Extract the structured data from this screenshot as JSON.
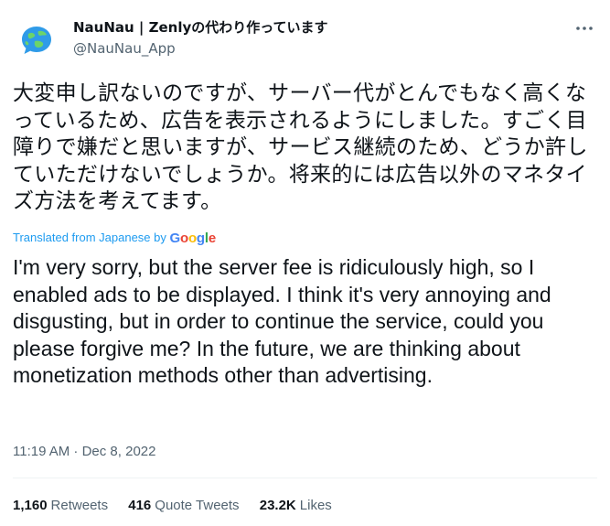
{
  "author": {
    "display_name": "NauNau | Zenlyの代わり作っています",
    "handle": "@NauNau_App",
    "avatar_icon": "globe-chat-bubble-icon"
  },
  "more_button_icon": "more-horizontal-icon",
  "tweet": {
    "original_text": "大変申し訳ないのですが、サーバー代がとんでもなく高くなっているため、広告を表示されるようにしました。すごく目障りで嫌だと思いますが、サービス継続のため、どうか許していただけないでしょうか。将来的には広告以外のマネタイズ方法を考えてます。",
    "translated_from": "Translated from Japanese by",
    "translator": "Google",
    "translated_text": "I'm very sorry, but the server fee is ridiculously high, so I enabled ads to be displayed. I think it's very annoying and disgusting, but in order to continue the service, could you please forgive me? In the future, we are thinking about monetization methods other than advertising.",
    "timestamp": "11:19 AM · Dec 8, 2022"
  },
  "stats": {
    "retweets_count": "1,160",
    "retweets_label": "Retweets",
    "quote_tweets_count": "416",
    "quote_tweets_label": "Quote Tweets",
    "likes_count": "23.2K",
    "likes_label": "Likes"
  },
  "colors": {
    "text_primary": "#0f1419",
    "text_secondary": "#536471",
    "link_blue": "#1d9bf0",
    "divider": "#eff3f4",
    "google_blue": "#4285F4",
    "google_red": "#EA4335",
    "google_yellow": "#FBBC05",
    "google_green": "#34A853"
  }
}
